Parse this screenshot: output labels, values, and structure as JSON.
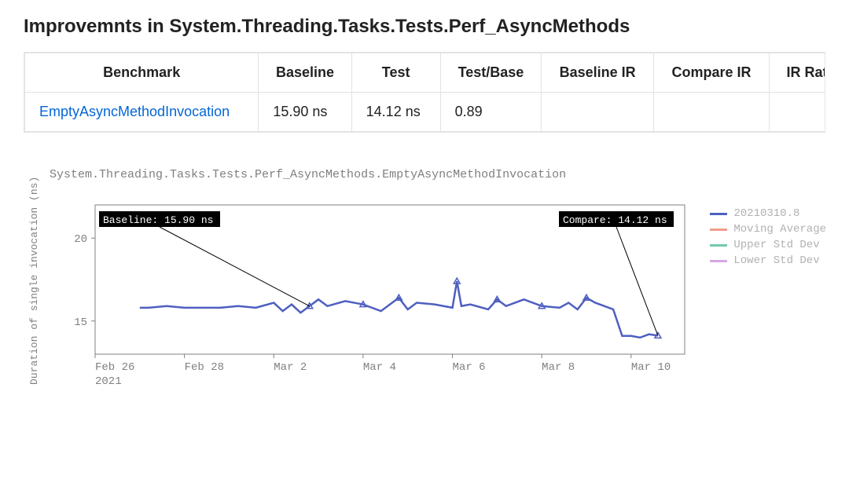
{
  "title": "Improvemnts in System.Threading.Tasks.Tests.Perf_AsyncMethods",
  "table": {
    "headers": [
      "Benchmark",
      "Baseline",
      "Test",
      "Test/Base",
      "Baseline IR",
      "Compare IR",
      "IR Ratio"
    ],
    "rows": [
      {
        "name": "EmptyAsyncMethodInvocation",
        "baseline": "15.90 ns",
        "test": "14.12 ns",
        "ratio": "0.89",
        "bir": "",
        "cir": "",
        "irr": ""
      }
    ]
  },
  "chart_data": {
    "type": "line",
    "title": "System.Threading.Tasks.Tests.Perf_AsyncMethods.EmptyAsyncMethodInvocation",
    "xlabel": "",
    "ylabel": "Duration of single invocation (ns)",
    "ylim": [
      13,
      22
    ],
    "yticks": [
      15,
      20
    ],
    "xticks": [
      "Feb 26",
      "Feb 28",
      "Mar 2",
      "Mar 4",
      "Mar 6",
      "Mar 8",
      "Mar 10"
    ],
    "xsubtitle": "2021",
    "series": [
      {
        "name": "20210310.8",
        "color": "#4e5fc0"
      },
      {
        "name": "Moving Average",
        "color": "#f09c8c"
      },
      {
        "name": "Upper Std Dev",
        "color": "#6fcab0"
      },
      {
        "name": "Lower Std Dev",
        "color": "#d5a8e5"
      }
    ],
    "annotations": [
      {
        "label": "Baseline: 15.90 ns",
        "x_index": 2.4,
        "value": 15.9
      },
      {
        "label": "Compare: 14.12 ns",
        "x_index": 6.3,
        "value": 14.12
      }
    ],
    "x": [
      0.5,
      0.6,
      0.8,
      1.0,
      1.2,
      1.4,
      1.6,
      1.8,
      2.0,
      2.1,
      2.2,
      2.3,
      2.4,
      2.5,
      2.6,
      2.8,
      3.0,
      3.2,
      3.3,
      3.4,
      3.5,
      3.6,
      3.8,
      4.0,
      4.05,
      4.1,
      4.2,
      4.4,
      4.5,
      4.6,
      4.8,
      5.0,
      5.2,
      5.3,
      5.4,
      5.5,
      5.6,
      5.8,
      5.9,
      6.0,
      6.1,
      6.2,
      6.3
    ],
    "values": [
      15.8,
      15.8,
      15.9,
      15.8,
      15.8,
      15.8,
      15.9,
      15.8,
      16.1,
      15.6,
      16.0,
      15.5,
      15.9,
      16.3,
      15.9,
      16.2,
      16.0,
      15.6,
      16.0,
      16.4,
      15.7,
      16.1,
      16.0,
      15.8,
      17.4,
      15.9,
      16.0,
      15.7,
      16.3,
      15.9,
      16.3,
      15.9,
      15.8,
      16.1,
      15.7,
      16.4,
      16.1,
      15.7,
      14.1,
      14.1,
      14.0,
      14.2,
      14.12
    ]
  },
  "legend_items": [
    "20210310.8",
    "Moving Average",
    "Upper Std Dev",
    "Lower Std Dev"
  ]
}
